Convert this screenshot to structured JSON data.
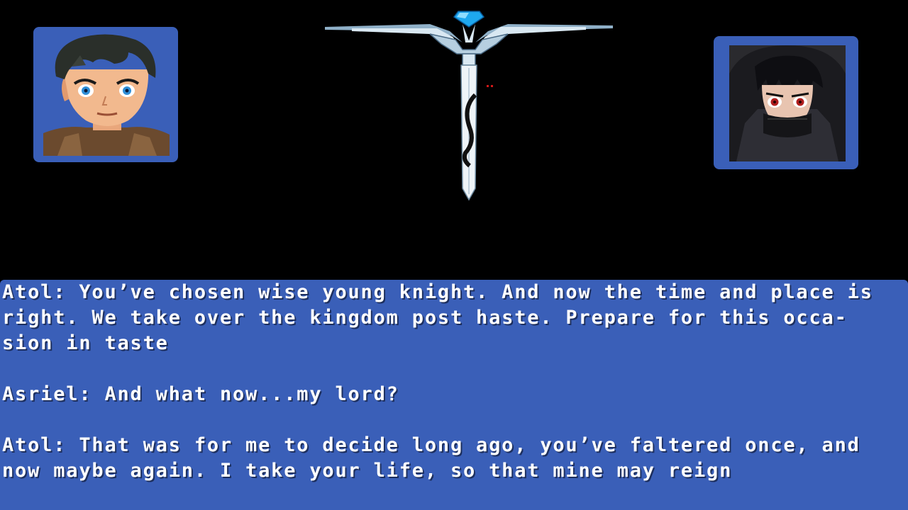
{
  "portraits": {
    "left": {
      "character": "Asriel",
      "icon": "young-knight-portrait"
    },
    "right": {
      "character": "Atol",
      "icon": "hooded-dark-lord-portrait"
    }
  },
  "center_sprite": {
    "icon": "winged-sword-sprite",
    "gem_color": "#1ea8f0"
  },
  "colors": {
    "dialogue_bg": "#3a5fb8",
    "text": "#ffffff",
    "background": "#000000"
  },
  "dialogue": {
    "paragraph1": {
      "line1": "Atol: You’ve chosen wise young knight. And now the time and place is",
      "line2": "right. We take over the kingdom post haste. Prepare for this occa-",
      "line3": "sion in taste"
    },
    "paragraph2": {
      "line1": "Asriel: And what now...my lord?"
    },
    "paragraph3": {
      "line1": "Atol: That was for me to decide long ago, you’ve faltered once, and",
      "line2": "now maybe again. I take your life, so that mine may reign"
    }
  }
}
